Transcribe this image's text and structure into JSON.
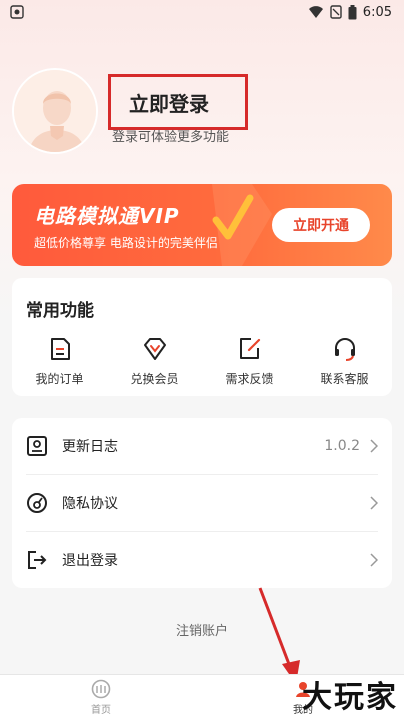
{
  "status_bar": {
    "time": "6:05"
  },
  "profile": {
    "login_title": "立即登录",
    "login_subtitle": "登录可体验更多功能"
  },
  "vip_banner": {
    "title": "电路模拟通VIP",
    "subtitle": "超低价格尊享  电路设计的完美伴侣",
    "button": "立即开通",
    "accent": "#ff5a3c"
  },
  "functions": {
    "title": "常用功能",
    "items": [
      {
        "label": "我的订单",
        "icon": "order-icon"
      },
      {
        "label": "兑换会员",
        "icon": "diamond-icon"
      },
      {
        "label": "需求反馈",
        "icon": "feedback-edit-icon"
      },
      {
        "label": "联系客服",
        "icon": "headset-icon"
      }
    ]
  },
  "list": {
    "items": [
      {
        "label": "更新日志",
        "value": "1.0.2",
        "icon": "update-log-icon"
      },
      {
        "label": "隐私协议",
        "value": "",
        "icon": "privacy-icon"
      },
      {
        "label": "退出登录",
        "value": "",
        "icon": "logout-icon"
      }
    ]
  },
  "cancel_account": "注销账户",
  "tab_bar": {
    "tabs": [
      {
        "label": "首页",
        "icon": "home-icon"
      },
      {
        "label": "我的",
        "icon": "profile-icon"
      }
    ]
  },
  "watermark": "大玩家"
}
